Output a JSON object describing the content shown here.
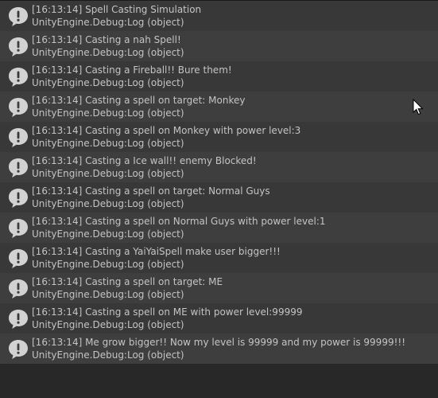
{
  "console": {
    "entries": [
      {
        "message": "[16:13:14] Spell Casting Simulation",
        "source": "UnityEngine.Debug:Log (object)",
        "icon": "info-speech-bubble-icon"
      },
      {
        "message": "[16:13:14] Casting a nah Spell!",
        "source": "UnityEngine.Debug:Log (object)",
        "icon": "info-speech-bubble-icon"
      },
      {
        "message": "[16:13:14] Casting a Fireball!! Bure them!",
        "source": "UnityEngine.Debug:Log (object)",
        "icon": "info-speech-bubble-icon"
      },
      {
        "message": "[16:13:14] Casting a spell on target: Monkey",
        "source": "UnityEngine.Debug:Log (object)",
        "icon": "info-speech-bubble-icon"
      },
      {
        "message": "[16:13:14] Casting a spell on Monkey with power level:3",
        "source": "UnityEngine.Debug:Log (object)",
        "icon": "info-speech-bubble-icon"
      },
      {
        "message": "[16:13:14] Casting a Ice wall!! enemy Blocked!",
        "source": "UnityEngine.Debug:Log (object)",
        "icon": "info-speech-bubble-icon"
      },
      {
        "message": "[16:13:14] Casting a spell on target: Normal Guys",
        "source": "UnityEngine.Debug:Log (object)",
        "icon": "info-speech-bubble-icon"
      },
      {
        "message": "[16:13:14] Casting a spell on Normal Guys with power level:1",
        "source": "UnityEngine.Debug:Log (object)",
        "icon": "info-speech-bubble-icon"
      },
      {
        "message": "[16:13:14] Casting a YaiYaiSpell make user bigger!!!",
        "source": "UnityEngine.Debug:Log (object)",
        "icon": "info-speech-bubble-icon"
      },
      {
        "message": "[16:13:14] Casting a spell on target: ME",
        "source": "UnityEngine.Debug:Log (object)",
        "icon": "info-speech-bubble-icon"
      },
      {
        "message": "[16:13:14] Casting a spell on ME with power level:99999",
        "source": "UnityEngine.Debug:Log (object)",
        "icon": "info-speech-bubble-icon"
      },
      {
        "message": "[16:13:14] Me grow bigger!! Now my level is 99999 and my power is 99999!!!",
        "source": "UnityEngine.Debug:Log (object)",
        "icon": "info-speech-bubble-icon"
      }
    ]
  },
  "colors": {
    "background": "#282828",
    "row_odd": "#383838",
    "row_even": "#3e3e3e",
    "text": "#c4c4c4",
    "icon": "#d2d2d2"
  }
}
